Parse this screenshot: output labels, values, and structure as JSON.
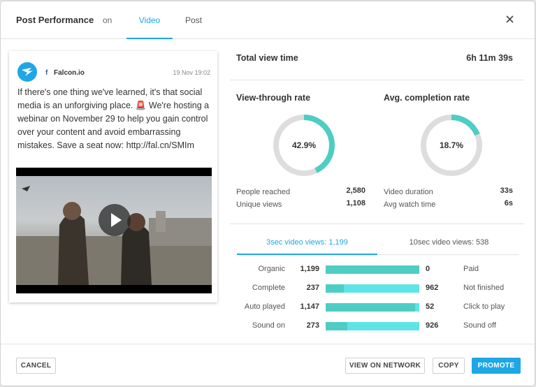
{
  "header": {
    "title": "Post Performance",
    "on_label": "on",
    "tabs": [
      {
        "label": "Video",
        "active": true
      },
      {
        "label": "Post",
        "active": false
      }
    ],
    "close_icon": "close-icon"
  },
  "post": {
    "brand": "Falcon.io",
    "network_icon": "facebook-icon",
    "date": "19 Nov 19:02",
    "text": "If there's one thing we've learned, it's that social media is an unforgiving place. 🚨 We're hosting a webinar on November 29 to help you gain control over your content and avoid embarrassing mistakes. Save a seat now: http://fal.cn/SMIm",
    "video_icon": "play-icon"
  },
  "stats": {
    "total_view_time_label": "Total view time",
    "total_view_time_value": "6h 11m 39s",
    "view_through": {
      "title": "View-through rate",
      "percent_label": "42.9%",
      "percent": 42.9,
      "rows": [
        {
          "label": "People reached",
          "value": "2,580"
        },
        {
          "label": "Unique views",
          "value": "1,108"
        }
      ]
    },
    "completion": {
      "title": "Avg. completion rate",
      "percent_label": "18.7%",
      "percent": 18.7,
      "rows": [
        {
          "label": "Video duration",
          "value": "33s"
        },
        {
          "label": "Avg watch time",
          "value": "6s"
        }
      ]
    },
    "view_tabs": [
      {
        "label": "3sec video views: 1,199",
        "active": true
      },
      {
        "label": "10sec video views: 538",
        "active": false
      }
    ],
    "bars": [
      {
        "left_label": "Organic",
        "left_value": "1,199",
        "right_value": "0",
        "right_label": "Paid",
        "left_num": 1199,
        "right_num": 0
      },
      {
        "left_label": "Complete",
        "left_value": "237",
        "right_value": "962",
        "right_label": "Not finished",
        "left_num": 237,
        "right_num": 962
      },
      {
        "left_label": "Auto played",
        "left_value": "1,147",
        "right_value": "52",
        "right_label": "Click to play",
        "left_num": 1147,
        "right_num": 52
      },
      {
        "left_label": "Sound on",
        "left_value": "273",
        "right_value": "926",
        "right_label": "Sound off",
        "left_num": 273,
        "right_num": 926
      }
    ]
  },
  "footer": {
    "cancel": "CANCEL",
    "view_on_network": "VIEW ON NETWORK",
    "copy": "COPY",
    "promote": "PROMOTE"
  },
  "colors": {
    "accent": "#1ea7e4",
    "donut_fill": "#4ecdc4",
    "donut_track": "#dddddd",
    "bar_light": "#5ee4e6",
    "bar_dark": "#4ecdc4"
  }
}
